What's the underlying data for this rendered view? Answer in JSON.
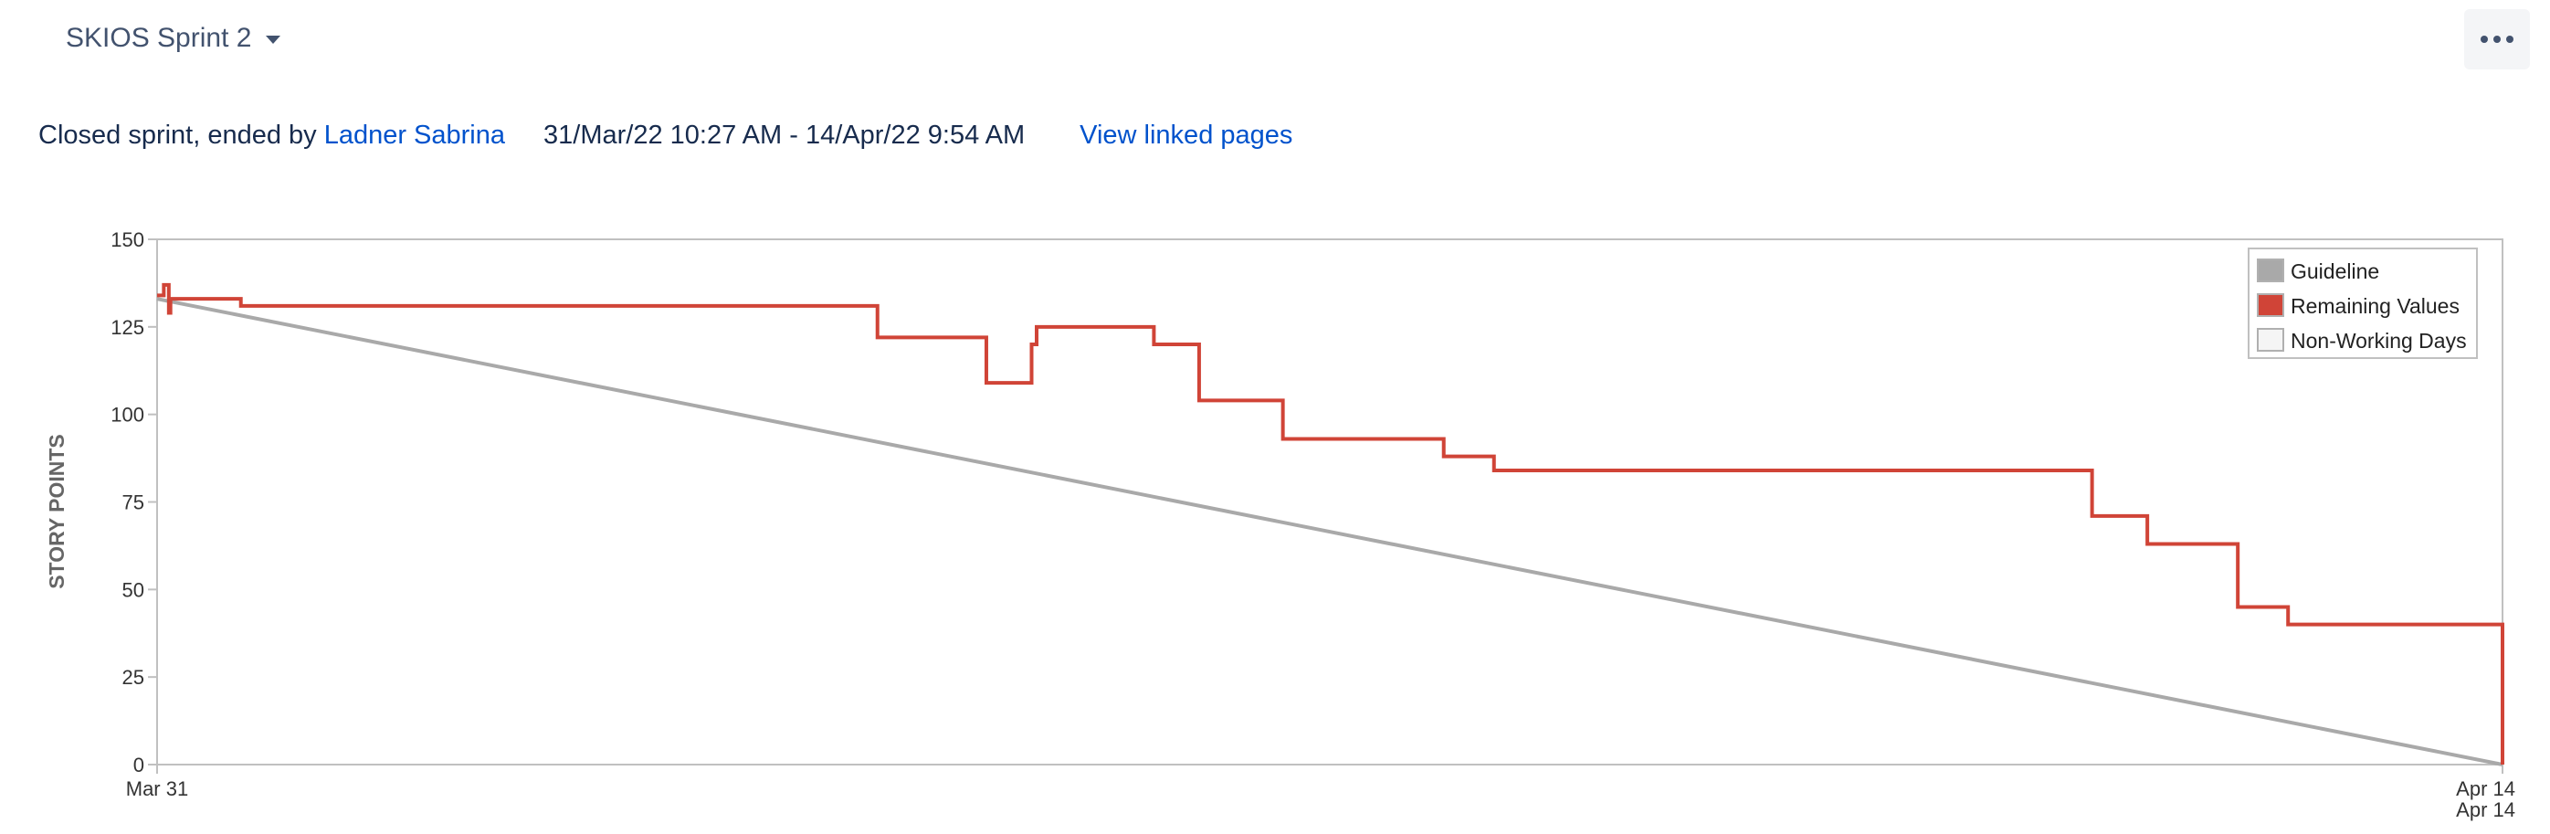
{
  "header": {
    "sprint_name": "SKIOS Sprint 2",
    "more_icon": "more-horizontal-icon",
    "status_prefix": "Closed sprint, ended by",
    "ended_by": "Ladner Sabrina",
    "date_range": "31/Mar/22 10:27 AM - 14/Apr/22 9:54 AM",
    "view_linked_pages": "View linked pages"
  },
  "colors": {
    "guideline": "#a9a9a9",
    "remaining": "#d04437",
    "non_working": "#f5f5f5",
    "link": "#0052cc"
  },
  "chart_data": {
    "type": "line",
    "title": "",
    "xlabel": "",
    "ylabel": "STORY POINTS",
    "x_range": [
      0,
      14
    ],
    "ylim": [
      0,
      150
    ],
    "y_ticks": [
      0,
      25,
      50,
      75,
      100,
      125,
      150
    ],
    "x_ticks": [
      {
        "x": 0,
        "label": "Mar 31"
      },
      {
        "x": 14,
        "label": "Apr 14"
      }
    ],
    "x_tick_extra_label": "Apr 14",
    "grid": false,
    "legend_position": "top-right",
    "legend": [
      "Guideline",
      "Remaining Values",
      "Non-Working Days"
    ],
    "series": [
      {
        "name": "Guideline",
        "step": false,
        "points": [
          [
            0,
            133
          ],
          [
            14,
            0
          ]
        ]
      },
      {
        "name": "Remaining Values",
        "step": true,
        "points": [
          [
            0,
            134
          ],
          [
            0.04,
            137
          ],
          [
            0.07,
            129
          ],
          [
            0.08,
            133
          ],
          [
            0.5,
            131
          ],
          [
            4.3,
            122
          ],
          [
            4.95,
            109
          ],
          [
            5.22,
            120
          ],
          [
            5.25,
            125
          ],
          [
            5.95,
            120
          ],
          [
            6.22,
            104
          ],
          [
            6.72,
            93
          ],
          [
            7.68,
            88
          ],
          [
            7.98,
            84
          ],
          [
            11.55,
            71
          ],
          [
            11.88,
            63
          ],
          [
            12.42,
            45
          ],
          [
            12.72,
            40
          ],
          [
            14,
            0
          ]
        ]
      }
    ]
  }
}
